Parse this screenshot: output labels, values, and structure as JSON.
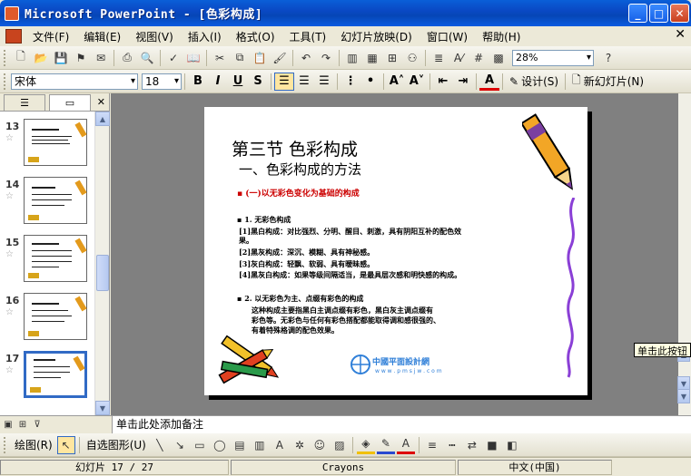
{
  "window": {
    "title": "Microsoft PowerPoint - [色彩构成]"
  },
  "menu": [
    "文件(F)",
    "编辑(E)",
    "视图(V)",
    "插入(I)",
    "格式(O)",
    "工具(T)",
    "幻灯片放映(D)",
    "窗口(W)",
    "帮助(H)"
  ],
  "toolbar": {
    "zoom": "28%"
  },
  "format": {
    "font": "宋体",
    "size": "18",
    "bold": "B",
    "italic": "I",
    "underline": "U",
    "shadow": "S",
    "design": "设计(S)",
    "new_slide": "新幻灯片(N)"
  },
  "thumbnails": [
    {
      "num": "13"
    },
    {
      "num": "14"
    },
    {
      "num": "15"
    },
    {
      "num": "16"
    },
    {
      "num": "17"
    }
  ],
  "slide": {
    "title": "第三节   色彩构成",
    "subtitle": "一、色彩构成的方法",
    "red_heading": "▪   (一)以无彩色变化为基础的构成",
    "h1": "▪   1. 无彩色构成",
    "lines": [
      "[1]黑白构成：对比强烈、分明、醒目、刺激，具有阴阳互补的配色效",
      "     果。",
      "[2]黑灰构成：深沉、模糊、具有神秘感。",
      "[3]灰白构成：轻飘、软弱、具有暧昧感。",
      "[4]黑灰白构成：如果等级间隔适当，是最具层次感和明快感的构成。"
    ],
    "h2": "▪   2. 以无彩色为主、点缀有彩色的构成",
    "para": [
      "          这种构成主要指黑白主调点缀有彩色，黑白灰主调点缀有",
      "彩色等。无彩色与任何有彩色搭配都能取得调和感很强的、",
      "有着特殊格调的配色效果。"
    ],
    "logo_text": "中國平面設計網",
    "logo_url": "w w w . p m s j w . c o m"
  },
  "tooltip": "单击此按钮",
  "notes": {
    "placeholder": "单击此处添加备注"
  },
  "drawing": {
    "draw": "绘图(R)",
    "autoshape": "自选图形(U)"
  },
  "status": {
    "slide": "幻灯片 17 / 27",
    "design": "Crayons",
    "lang": "中文(中国)"
  }
}
